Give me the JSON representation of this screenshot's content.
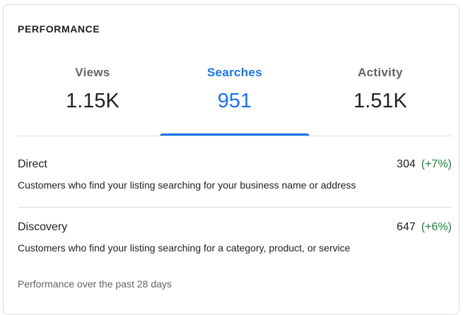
{
  "card": {
    "heading": "PERFORMANCE",
    "tabs": [
      {
        "label": "Views",
        "value": "1.15K",
        "active": false
      },
      {
        "label": "Searches",
        "value": "951",
        "active": true
      },
      {
        "label": "Activity",
        "value": "1.51K",
        "active": false
      }
    ],
    "breakdown": [
      {
        "title": "Direct",
        "count": "304",
        "change": "(+7%)",
        "description": "Customers who find your listing searching for your business name or address"
      },
      {
        "title": "Discovery",
        "count": "647",
        "change": "(+6%)",
        "description": "Customers who find your listing searching for a category, product, or service"
      }
    ],
    "footnote": "Performance over the past 28 days"
  },
  "colors": {
    "accent": "#1a73e8",
    "positive_change": "#188038",
    "muted_text": "#5f6368",
    "divider": "#dadce0"
  }
}
